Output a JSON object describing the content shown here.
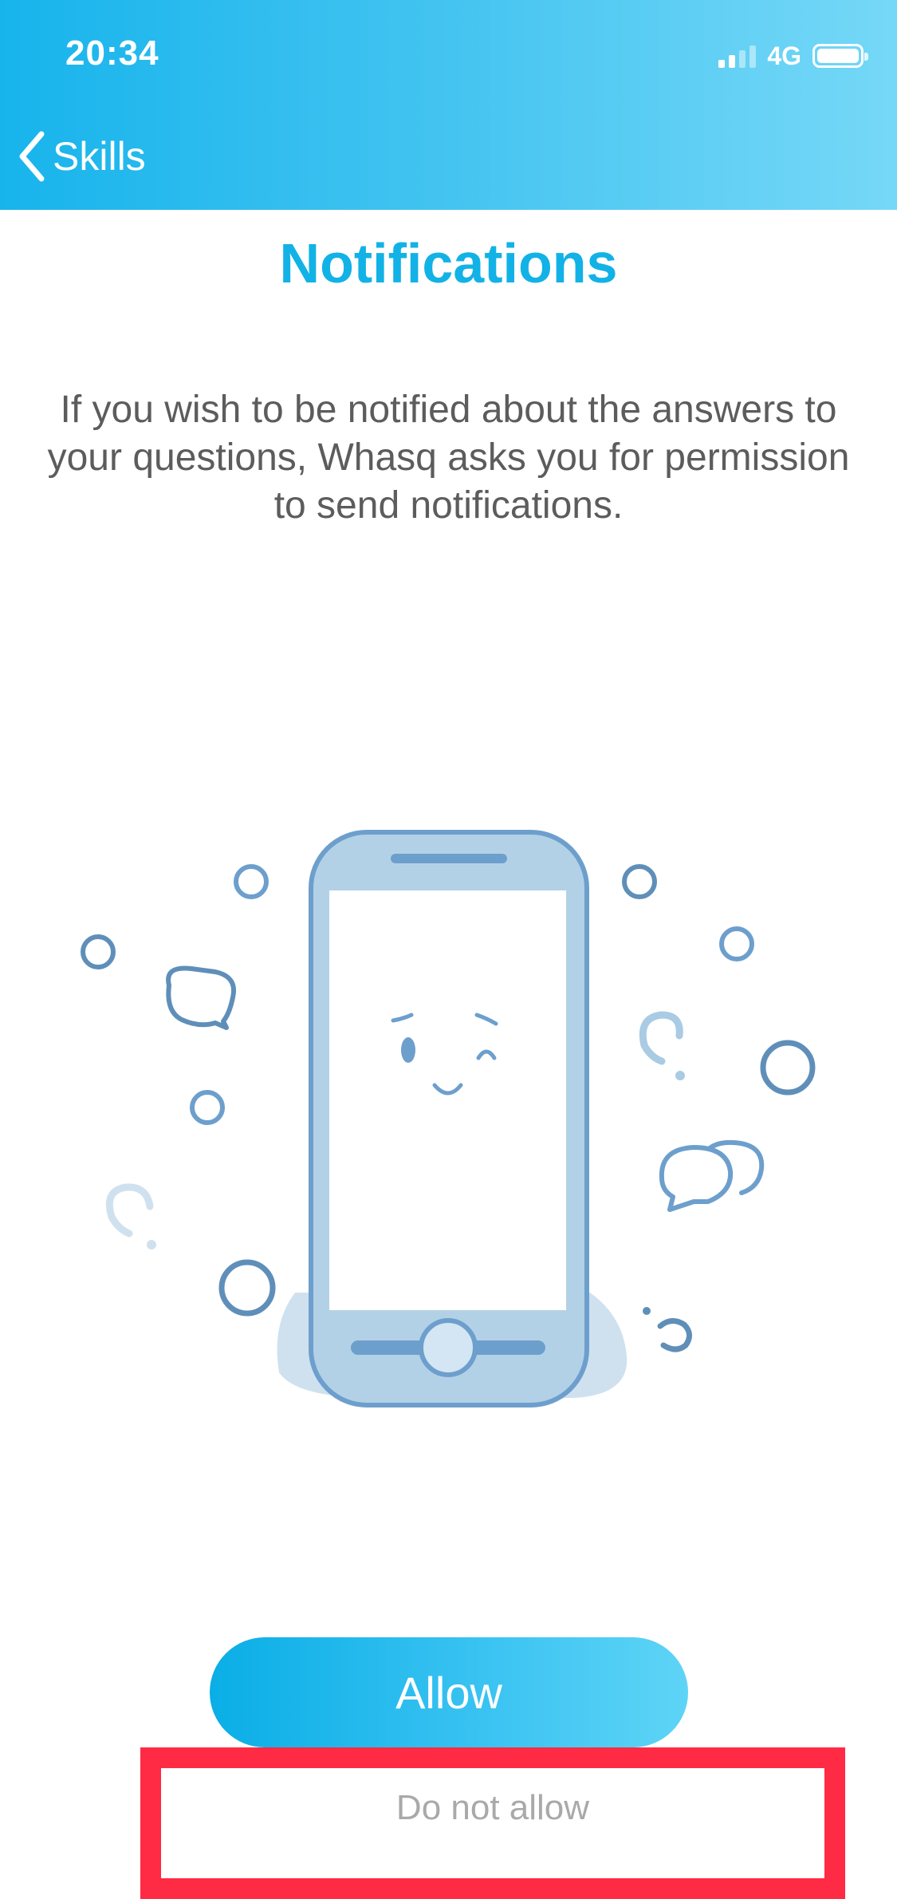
{
  "status_bar": {
    "time": "20:34",
    "network": "4G"
  },
  "nav": {
    "back_label": "Skills"
  },
  "main": {
    "title": "Notifications",
    "description": "If you wish to be notified about the answers to your questions, Whasq asks you for permission to send notifications."
  },
  "actions": {
    "allow_label": "Allow",
    "deny_label": "Do not allow"
  },
  "colors": {
    "accent": "#12b2e6",
    "highlight": "#ff2b44",
    "illustration": "#6fa3cf"
  }
}
